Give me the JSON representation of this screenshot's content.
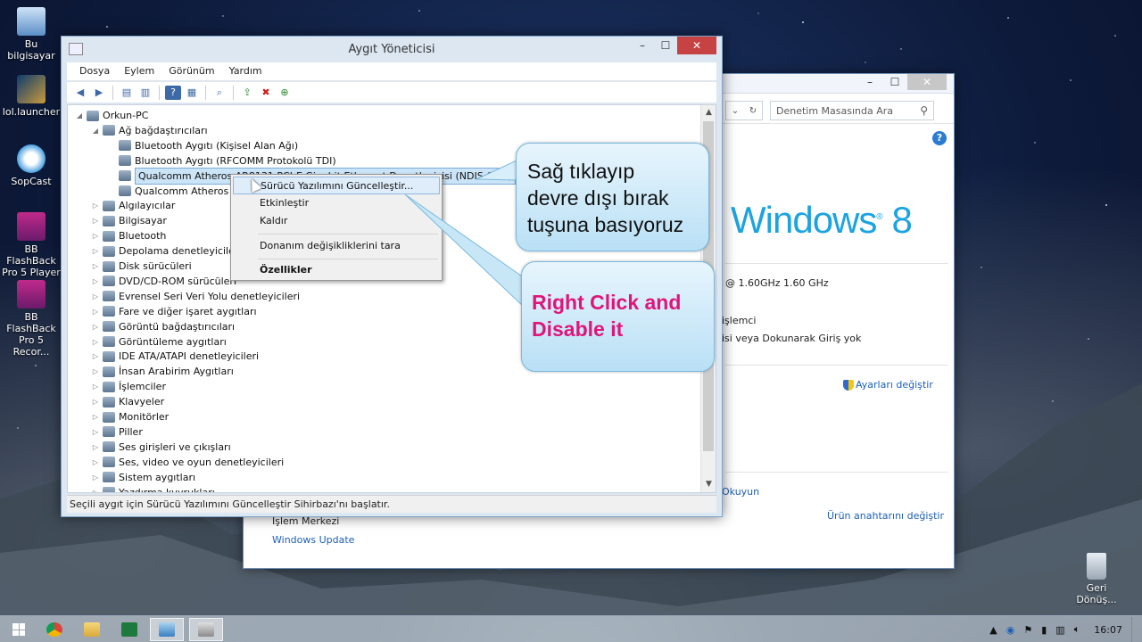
{
  "desktop": {
    "icons": [
      {
        "label": "Bu bilgisayar"
      },
      {
        "label": "lol.launcher"
      },
      {
        "label": "SopCast"
      },
      {
        "label": "BB FlashBack Pro 5 Player"
      },
      {
        "label": "BB FlashBack Pro 5 Recor..."
      }
    ],
    "recycle_bin": "Geri Dönüş..."
  },
  "system_window": {
    "search_placeholder": "Denetim Masasında Ara",
    "logo_text": "Windows",
    "logo_number": "8",
    "cpu_speed": "@ 1.60GHz   1.60 GHz",
    "processor_text": "işlemci",
    "touch_text": "isi veya Dokunarak Giriş yok",
    "change_settings": "Ayarları değiştir",
    "read_link": "Okuyun",
    "action_center": "İşlem Merkezi",
    "windows_update": "Windows Update",
    "change_key": "Ürün anahtarını değiştir"
  },
  "device_manager": {
    "title": "Aygıt Yöneticisi",
    "menu": [
      "Dosya",
      "Eylem",
      "Görünüm",
      "Yardım"
    ],
    "tree": [
      {
        "label": "Orkun-PC",
        "level": 0,
        "expanded": true
      },
      {
        "label": "Ağ bağdaştırıcıları",
        "level": 1,
        "expanded": true
      },
      {
        "label": "Bluetooth Aygıtı (Kişisel Alan Ağı)",
        "level": 2
      },
      {
        "label": "Bluetooth Aygıtı (RFCOMM Protokolü TDI)",
        "level": 2
      },
      {
        "label": "Qualcomm Atheros AR8131 PCI-E Gigabit Ethernet Denetleyicisi (NDIS 6.30)",
        "level": 2,
        "selected": true
      },
      {
        "label": "Qualcomm Atheros AR9285 Kablosuz Ağ Bağdaştırıcısı",
        "level": 2
      },
      {
        "label": "Algılayıcılar",
        "level": 1
      },
      {
        "label": "Bilgisayar",
        "level": 1
      },
      {
        "label": "Bluetooth",
        "level": 1
      },
      {
        "label": "Depolama denetleyicileri",
        "level": 1
      },
      {
        "label": "Disk sürücüleri",
        "level": 1
      },
      {
        "label": "DVD/CD-ROM sürücüleri",
        "level": 1
      },
      {
        "label": "Evrensel Seri Veri Yolu denetleyicileri",
        "level": 1
      },
      {
        "label": "Fare ve diğer işaret aygıtları",
        "level": 1
      },
      {
        "label": "Görüntü bağdaştırıcıları",
        "level": 1
      },
      {
        "label": "Görüntüleme aygıtları",
        "level": 1
      },
      {
        "label": "IDE ATA/ATAPI denetleyicileri",
        "level": 1
      },
      {
        "label": "İnsan Arabirim Aygıtları",
        "level": 1
      },
      {
        "label": "İşlemciler",
        "level": 1
      },
      {
        "label": "Klavyeler",
        "level": 1
      },
      {
        "label": "Monitörler",
        "level": 1
      },
      {
        "label": "Piller",
        "level": 1
      },
      {
        "label": "Ses girişleri ve çıkışları",
        "level": 1
      },
      {
        "label": "Ses, video ve oyun denetleyicileri",
        "level": 1
      },
      {
        "label": "Sistem aygıtları",
        "level": 1
      },
      {
        "label": "Yazdırma kuyrukları",
        "level": 1
      }
    ],
    "status": "Seçili aygıt için Sürücü Yazılımını Güncelleştir Sihirbazı'nı başlatır."
  },
  "context_menu": {
    "items": [
      "Sürücü Yazılımını Güncelleştir...",
      "Etkinleştir",
      "Kaldır",
      "Donanım değişikliklerini tara",
      "Özellikler"
    ]
  },
  "callouts": {
    "turkish_line1": "Sağ tıklayıp",
    "turkish_line2": "devre dışı bırak",
    "turkish_line3": "tuşuna basıyoruz",
    "english_line1": "Right Click and",
    "english_line2": "Disable it"
  },
  "taskbar": {
    "clock": "16:07"
  }
}
